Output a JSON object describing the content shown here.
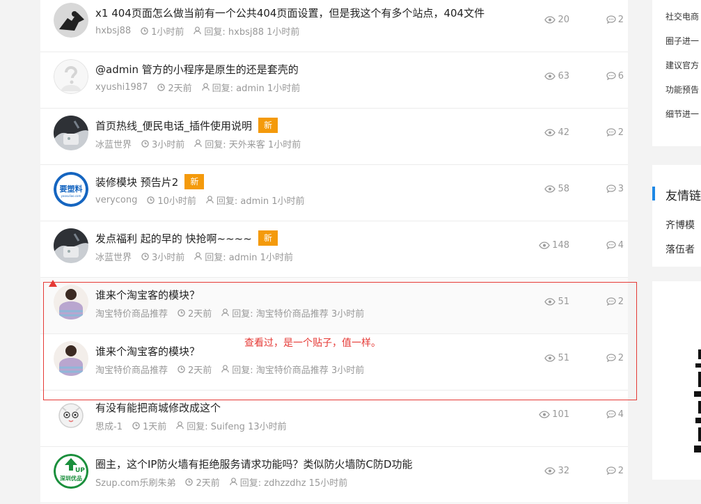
{
  "threads": [
    {
      "title": "x1 404页面怎么做当前有一个公共404页面设置，但是我这个有多个站点，404文件",
      "author": "hxbsj88",
      "time": "1小时前",
      "reply": "回复: hxbsj88 1小时前",
      "views": "20",
      "replies": "2",
      "badge": ""
    },
    {
      "title": "@admin 管方的小程序是原生的还是套壳的",
      "author": "xyushi1987",
      "time": "2天前",
      "reply": "回复: admin 1小时前",
      "views": "63",
      "replies": "6",
      "badge": ""
    },
    {
      "title": "首页热线_便民电话_插件使用说明",
      "author": "冰蓝世界",
      "time": "3小时前",
      "reply": "回复: 天外来客 1小时前",
      "views": "42",
      "replies": "2",
      "badge": "新"
    },
    {
      "title": "装修模块 预告片2",
      "author": "verycong",
      "time": "10小时前",
      "reply": "回复: admin 1小时前",
      "views": "58",
      "replies": "3",
      "badge": "新"
    },
    {
      "title": "发点福利 起的早的 快抢啊~~~~",
      "author": "冰蓝世界",
      "time": "3小时前",
      "reply": "回复: admin 1小时前",
      "views": "148",
      "replies": "4",
      "badge": "新"
    },
    {
      "title": "谁来个淘宝客的模块？",
      "author": "淘宝特价商品推荐",
      "time": "2天前",
      "reply": "回复: 淘宝特价商品推荐 3小时前",
      "views": "51",
      "replies": "2",
      "badge": ""
    },
    {
      "title": "谁来个淘宝客的模块？",
      "author": "淘宝特价商品推荐",
      "time": "2天前",
      "reply": "回复: 淘宝特价商品推荐 3小时前",
      "views": "51",
      "replies": "2",
      "badge": ""
    },
    {
      "title": "有没有能把商城修改成这个",
      "author": "思成-1",
      "time": "1天前",
      "reply": "回复: Suifeng 13小时前",
      "views": "101",
      "replies": "4",
      "badge": ""
    },
    {
      "title": "圈主，这个IP防火墙有拒绝服务请求功能吗？类似防火墙防C防D功能",
      "author": "Szup.com乐刷朱弟",
      "time": "2天前",
      "reply": "回复: zdhzzdhz 15小时前",
      "views": "32",
      "replies": "2",
      "badge": ""
    }
  ],
  "avatar_text": {
    "yaosuliao": "要塑料",
    "yaosuliao_url": "yaosuliao.com",
    "szup_top": "UP",
    "szup_bottom": "深圳优品"
  },
  "sidebar": {
    "links": [
      "社交电商",
      "圈子进一",
      "建议官方",
      "功能预告",
      "细节进一"
    ],
    "friend_heading": "友情链",
    "friend_links": [
      "齐博模",
      "落伍者"
    ]
  },
  "annotation": {
    "note": "查看过，是一个贴子，值一样。"
  },
  "colors": {
    "badge": "#f49a0b",
    "annotation": "#e53935",
    "accent": "#1e88e5"
  }
}
